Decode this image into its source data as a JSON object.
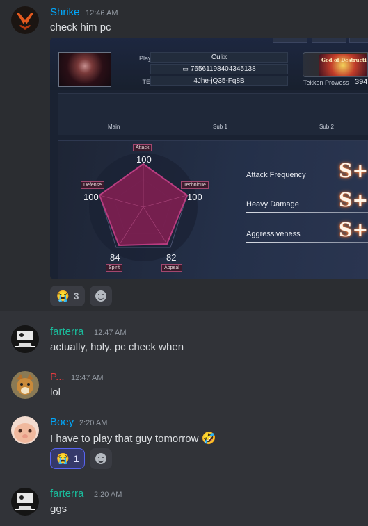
{
  "colors": {
    "background": "#313338",
    "hover": "#2b2d31",
    "accent": "#5865f2"
  },
  "messages": [
    {
      "username": "Shrike",
      "username_color": "#00a8fc",
      "timestamp": "12:46 AM",
      "text": "check him pc",
      "avatar": "orange-mask-avatar"
    },
    {
      "username": "farterra",
      "username_color": "#1abc9c",
      "timestamp": "12:47 AM",
      "text": "actually, holy. pc check when",
      "avatar": "comic-avatar"
    },
    {
      "username": "P...",
      "username_color": "#e03a3e",
      "timestamp": "12:47 AM",
      "text": "lol",
      "avatar": "fox-avatar"
    },
    {
      "username": "Boey",
      "username_color": "#00a8fc",
      "timestamp": "2:20 AM",
      "text": "I have to play that guy tomorrow",
      "avatar": "hamster-avatar",
      "trailing_emoji": "🤣"
    },
    {
      "username": "farterra",
      "username_color": "#1abc9c",
      "timestamp": "2:20 AM",
      "text": "ggs",
      "avatar": "comic-avatar"
    }
  ],
  "reactions": {
    "shrike": {
      "emoji": "😭",
      "count": "3",
      "active": false
    },
    "boey": {
      "emoji": "😭",
      "count": "1",
      "active": true
    }
  },
  "card": {
    "player_name_label": "Player Name",
    "player_name": "Culix",
    "steam_id_label": "Steam ID",
    "steam_id": "76561198404345138",
    "tekken_id_label": "TEKKEN ID",
    "tekken_id": "4Jhe-jQ35-Fq8B",
    "rank_text": "God of Destruction",
    "prowess_label": "Tekken Prowess",
    "prowess_value": "394",
    "mid_labels": [
      "Main",
      "Sub 1",
      "Sub 2"
    ],
    "radar": {
      "stats": [
        {
          "label": "Attack",
          "value": "100"
        },
        {
          "label": "Technique",
          "value": "100"
        },
        {
          "label": "Appeal",
          "value": "82"
        },
        {
          "label": "Spirit",
          "value": "84"
        },
        {
          "label": "Defense",
          "value": "100"
        }
      ]
    },
    "playstyle": [
      {
        "label": "Attack Frequency",
        "grade": "S+"
      },
      {
        "label": "Heavy Damage",
        "grade": "S+"
      },
      {
        "label": "Aggressiveness",
        "grade": "S+"
      }
    ]
  }
}
